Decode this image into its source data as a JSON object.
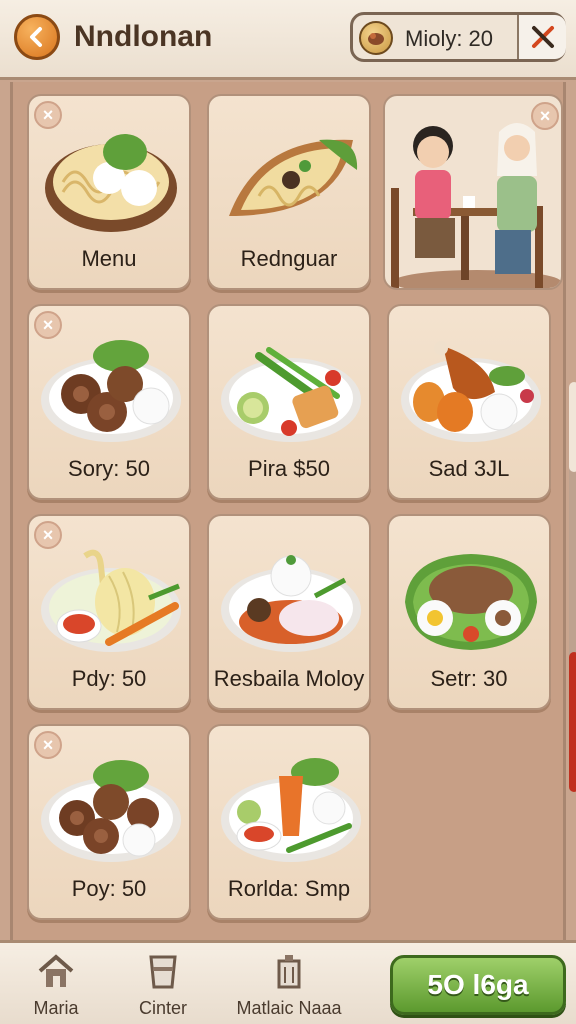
{
  "header": {
    "title": "Nndlonan",
    "money_label": "Mioly: 20",
    "back_icon": "back-arrow-icon",
    "close_icon": "close-x-icon"
  },
  "menu_items": [
    {
      "label": "Menu",
      "dish": "noodle-bowl-icon",
      "badge": true
    },
    {
      "label": "Rednguar",
      "dish": "noodle-leaf-plate-icon",
      "badge": false
    },
    {
      "label": "Sory: 50",
      "dish": "meat-rolls-rice-icon",
      "badge": true
    },
    {
      "label": "Pira $50",
      "dish": "vegetable-plate-icon",
      "badge": false
    },
    {
      "label": "Sad 3JL",
      "dish": "roast-chicken-plate-icon",
      "badge": false
    },
    {
      "label": "Pdy: 50",
      "dish": "cabbage-sauce-plate-icon",
      "badge": true
    },
    {
      "label": "Resbaila Moloy",
      "dish": "fish-rice-plate-icon",
      "badge": false
    },
    {
      "label": "Setr: 30",
      "dish": "lettuce-platter-icon",
      "badge": false
    },
    {
      "label": "Poy: 50",
      "dish": "meat-rolls-rice-icon",
      "badge": true
    },
    {
      "label": "Rorlda: Smp",
      "dish": "carrot-vegetable-plate-icon",
      "badge": false
    }
  ],
  "scene": {
    "name": "diners-at-table-illustration",
    "badge": true
  },
  "bottom_nav": [
    {
      "label": "Maria",
      "icon": "house-icon"
    },
    {
      "label": "Cinter",
      "icon": "cup-icon"
    },
    {
      "label": "Matlaic Naaa",
      "icon": "trash-bin-icon"
    }
  ],
  "buy_button": {
    "label": "5O l6ga"
  },
  "colors": {
    "accent_orange": "#d9751d",
    "buy_green": "#5c9a2e",
    "scroll_red": "#c0301f"
  }
}
